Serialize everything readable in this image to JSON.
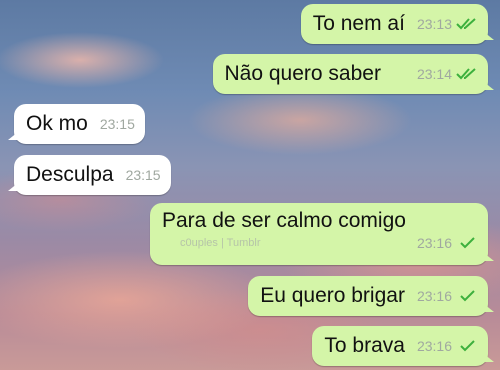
{
  "background": {
    "description": "sunset-sky-wallpaper"
  },
  "colors": {
    "outgoing": "#d4f5a8",
    "incoming": "#ffffff",
    "tick": "#3db03d",
    "time": "#a0a8a0"
  },
  "messages": [
    {
      "direction": "out",
      "text": "To nem aí",
      "time": "23:13",
      "status": "read-double-check"
    },
    {
      "direction": "out",
      "text": "Não quero saber",
      "time": "23:14",
      "status": "read-double-check"
    },
    {
      "direction": "in",
      "text": "Ok mo",
      "time": "23:15"
    },
    {
      "direction": "in",
      "text": "Desculpa",
      "time": "23:15"
    },
    {
      "direction": "out",
      "text": "Para de ser calmo comigo",
      "time": "23:16",
      "status": "sent-single-check",
      "watermark": "c0uples | Tumblr"
    },
    {
      "direction": "out",
      "text": "Eu quero brigar",
      "time": "23:16",
      "status": "sent-single-check"
    },
    {
      "direction": "out",
      "text": "To brava",
      "time": "23:16",
      "status": "sent-single-check"
    }
  ]
}
